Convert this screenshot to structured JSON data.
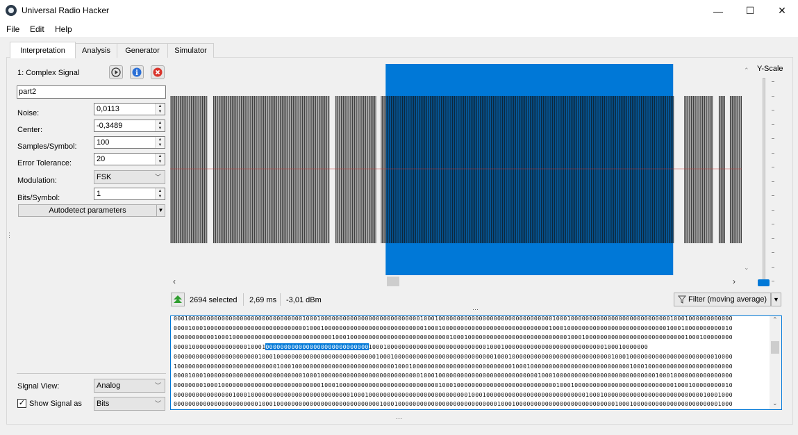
{
  "window": {
    "title": "Universal Radio Hacker",
    "minimize": "—",
    "maximize": "☐",
    "close": "✕"
  },
  "menu": [
    "File",
    "Edit",
    "Help"
  ],
  "tabs": [
    "Interpretation",
    "Analysis",
    "Generator",
    "Simulator"
  ],
  "signal": {
    "header": "1:  Complex Signal",
    "name": "part2",
    "fields": [
      {
        "label": "Noise:",
        "value": "0,0113"
      },
      {
        "label": "Center:",
        "value": "-0,3489"
      },
      {
        "label": "Samples/Symbol:",
        "value": "100"
      },
      {
        "label": "Error Tolerance:",
        "value": "20"
      }
    ],
    "modulation_label": "Modulation:",
    "modulation_value": "FSK",
    "bits_symbol_label": "Bits/Symbol:",
    "bits_symbol_value": "1",
    "autodetect_label": "Autodetect parameters",
    "signal_view_label": "Signal View:",
    "signal_view_value": "Analog",
    "show_signal_as_label": "Show Signal as",
    "show_signal_as_value": "Bits",
    "show_signal_as_checked": true
  },
  "plot": {
    "yscale_label": "Y-Scale",
    "selection_color": "#0078d7",
    "selection_start_fraction": 0.377,
    "selection_end_fraction": 0.88
  },
  "status": {
    "selected": "2694  selected",
    "duration": "2,69 ms",
    "power": "-3,01 dBm",
    "filter_label": "Filter (moving average)"
  },
  "bits": {
    "lines": [
      "00010000000000000000000000000000000100010000000000000000000000000001000100000000000000000000000000000001000100000000000000000000000000010001000000000000",
      "00001000100000000000000000000000000010001000000000000000000000000000100010000000000000000000000000000010001000000000000000000000000000100010000000000010",
      "00000000000100010000000000000000000000000001000100000000000000000000000000010001000000000000000000000000000100010000000000000000000000000001000100000000",
      {
        "pre": "0000100000000000000010001",
        "sel": "0000000000000000000000000000",
        "post": "1000100000000000000000000000000010001000000000000000000000000000100010000000"
      },
      "00000000000000000000000100010000000000000000000000000001000100000000000000000000000000010001000000000000000000000000000100010000000000000000000000010000",
      "10000000000000000000000000001000100000000000000000000000000010001000000000000000000000000000100010000000000000000000000000001000100000000000000000000000",
      "00001000100000000000000000000000000100010000000000000000000000000001000100000000000000000000000000010001000000000000000000000000000100010000000000000000",
      "00000000100010000000000000000000000000001000100000000000000000000000000010001000000000000000000000000000100010000000000000000000000000001000100000000010",
      "00000000000000001000100000000000000000000000000010001000000000000000000000000000100010000000000000000000000000001000100000000000000000000000000010001000",
      "00000000000000000000000100010000000000000000000000000000100010000000000000000000000000001000100000000000000000000000000010001000000000000000000000001000"
    ]
  }
}
